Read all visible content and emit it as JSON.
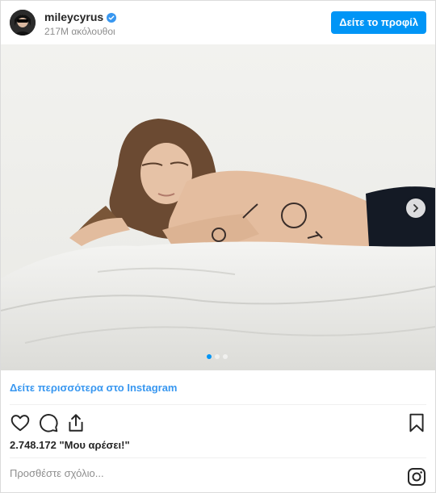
{
  "header": {
    "username": "mileycyrus",
    "followers": "217M ακόλουθοι",
    "view_profile_label": "Δείτε το προφίλ"
  },
  "carousel": {
    "total_slides": 3,
    "active_index": 0
  },
  "see_more_label": "Δείτε περισσότερα στο Instagram",
  "likes_text": "2.748.172 \"Μου αρέσει!\"",
  "comment": {
    "placeholder": "Προσθέστε σχόλιο..."
  },
  "icons": {
    "verified": "verified-badge-icon",
    "like": "heart-icon",
    "comment": "comment-bubble-icon",
    "share": "share-icon",
    "save": "bookmark-icon",
    "next": "chevron-right-icon",
    "brand": "instagram-logo-icon"
  },
  "colors": {
    "accent": "#0095f6",
    "link": "#3897f0",
    "muted": "#8e8e8e"
  }
}
